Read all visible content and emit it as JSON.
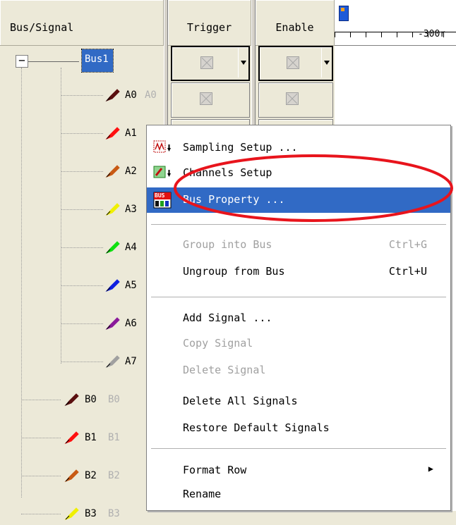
{
  "headers": {
    "bus_signal": "Bus/Signal",
    "trigger": "Trigger",
    "enable": "Enable",
    "timeline": "-300r"
  },
  "tree": {
    "collapse_glyph": "−",
    "bus1": "Bus1",
    "signals": [
      {
        "label": "A0",
        "alias": "A0",
        "color": "#5a0f0f"
      },
      {
        "label": "A1",
        "alias": "",
        "color": "#ff1010"
      },
      {
        "label": "A2",
        "alias": "",
        "color": "#c85a14"
      },
      {
        "label": "A3",
        "alias": "",
        "color": "#f0f000"
      },
      {
        "label": "A4",
        "alias": "",
        "color": "#10e010"
      },
      {
        "label": "A5",
        "alias": "",
        "color": "#1020e0"
      },
      {
        "label": "A6",
        "alias": "",
        "color": "#8a1a9a"
      },
      {
        "label": "A7",
        "alias": "",
        "color": "#a0a0a0"
      }
    ],
    "b_signals": [
      {
        "label": "B0",
        "alias": "B0",
        "color": "#5a0f0f"
      },
      {
        "label": "B1",
        "alias": "B1",
        "color": "#ff1010"
      },
      {
        "label": "B2",
        "alias": "B2",
        "color": "#c85a14"
      },
      {
        "label": "B3",
        "alias": "B3",
        "color": "#f0f000"
      }
    ]
  },
  "menu": {
    "sampling_setup": "Sampling Setup ...",
    "channels_setup": "Channels Setup",
    "bus_property": "Bus Property ...",
    "bus_icon_text": "BUS",
    "group_into_bus": "Group into Bus",
    "group_shortcut": "Ctrl+G",
    "ungroup_from_bus": "Ungroup from Bus",
    "ungroup_shortcut": "Ctrl+U",
    "add_signal": "Add Signal ...",
    "copy_signal": "Copy Signal",
    "delete_signal": "Delete Signal",
    "delete_all_signals": "Delete All Signals",
    "restore_default_signals": "Restore Default Signals",
    "format_row": "Format Row",
    "submenu_arrow": "▶",
    "rename": "Rename"
  },
  "colors": {
    "selection": "#316ac5",
    "highlight_ellipse": "#e8141c"
  }
}
